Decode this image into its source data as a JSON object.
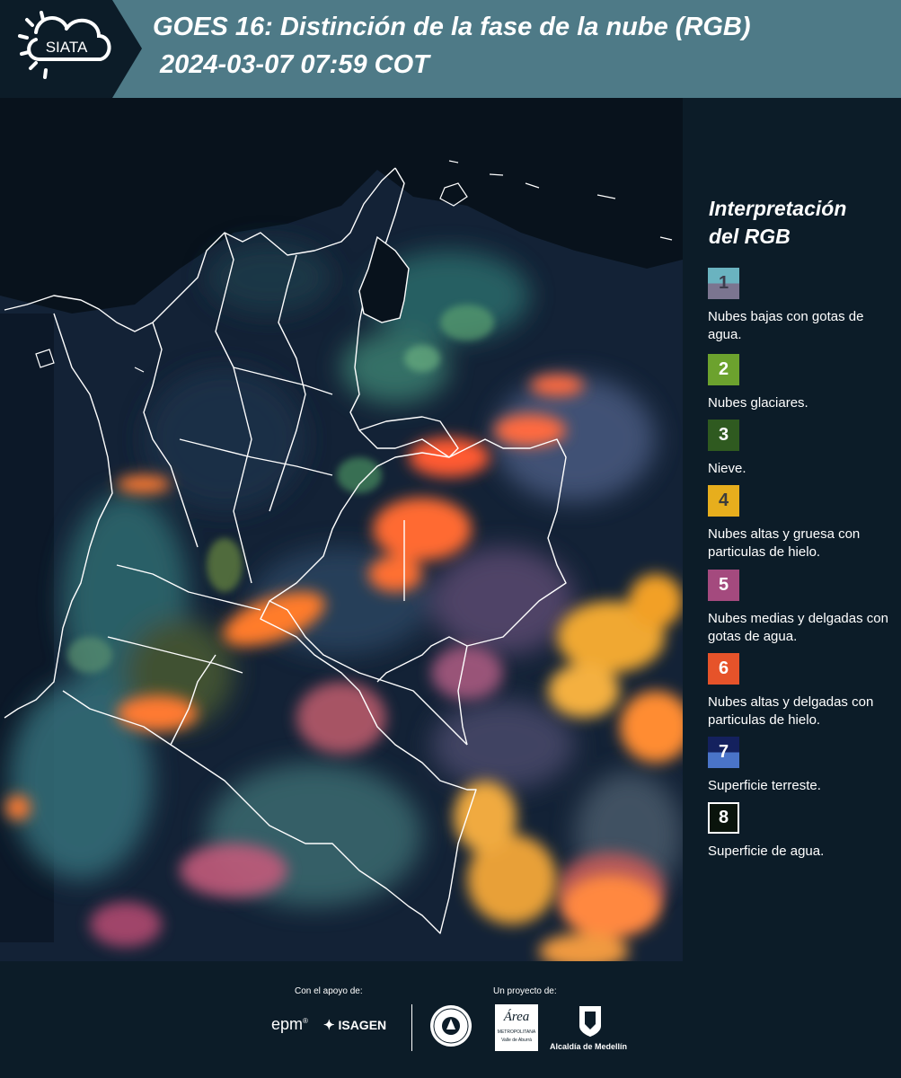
{
  "header": {
    "logo_text": "SIATA",
    "title_line1": "GOES 16: Distinción de la fase de la nube (RGB)",
    "title_line2": "2024-03-07 07:59 COT"
  },
  "legend": {
    "title_line1": "Interpretación",
    "title_line2": "del RGB",
    "items": [
      {
        "number": "1",
        "label": "Nubes bajas con gotas de agua.",
        "color_top": "#6ab3c0",
        "color_bottom": "#7b7590",
        "text_color": "#3c3c4c"
      },
      {
        "number": "2",
        "label": "Nubes glaciares.",
        "color_top": "#6ca22e",
        "color_bottom": "#6ca22e",
        "text_color": "#ffffff"
      },
      {
        "number": "3",
        "label": "Nieve.",
        "color_top": "#2f5a20",
        "color_bottom": "#2f5a20",
        "text_color": "#ffffff"
      },
      {
        "number": "4",
        "label": "Nubes altas y gruesa con particulas de hielo.",
        "color_top": "#e7ae1d",
        "color_bottom": "#e7ae1d",
        "text_color": "#3c3c3c"
      },
      {
        "number": "5",
        "label": "Nubes medias y delgadas con gotas de agua.",
        "color_top": "#a44a7e",
        "color_bottom": "#a44a7e",
        "text_color": "#ffffff"
      },
      {
        "number": "6",
        "label": "Nubes altas y delgadas con particulas de hielo.",
        "color_top": "#e6532a",
        "color_bottom": "#e6532a",
        "text_color": "#ffffff"
      },
      {
        "number": "7",
        "label": "Superficie terreste.",
        "color_top": "#14215e",
        "color_bottom": "#4a74c8",
        "text_color": "#ffffff"
      },
      {
        "number": "8",
        "label": "Superficie de agua.",
        "color_top": "#0a140c",
        "color_bottom": "#0a140c",
        "text_color": "#ffffff"
      }
    ]
  },
  "footer": {
    "support_caption": "Con el apoyo de:",
    "project_caption": "Un proyecto de:",
    "sponsor_epm": "epm",
    "sponsor_isagen": "ISAGEN",
    "sponsor_area_line1": "Área",
    "sponsor_area_line2": "METROPOLITANA",
    "sponsor_area_line3": "Valle de Aburrá",
    "sponsor_alcaldia": "Alcaldía de Medellín"
  },
  "colors": {
    "header_bg": "#4e7a87",
    "page_bg": "#0c1c28",
    "cloud_orange": "#ff7a30",
    "cloud_yellow": "#f0a830",
    "cloud_teal": "#3a8a80",
    "ocean_dark": "#0a1420",
    "border_white": "#ffffff"
  }
}
